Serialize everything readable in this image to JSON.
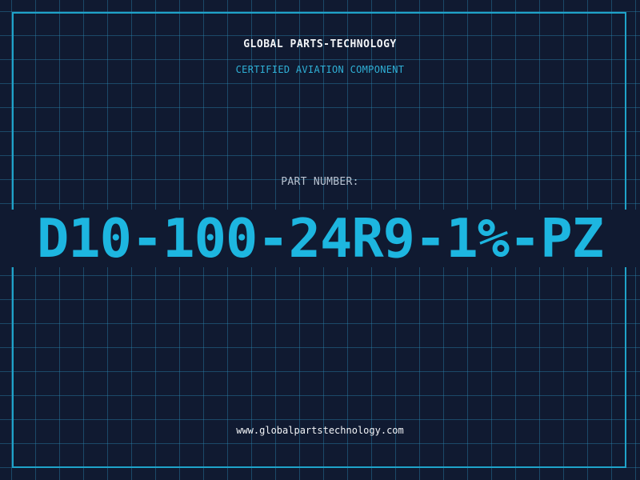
{
  "header": {
    "company_name": "GLOBAL PARTS-TECHNOLOGY",
    "tagline": "CERTIFIED AVIATION COMPONENT"
  },
  "part": {
    "label": "PART NUMBER:",
    "number": "D10-100-24R9-1%-PZ"
  },
  "footer": {
    "website": "www.globalpartstechnology.com"
  },
  "colors": {
    "background": "#101a31",
    "grid": "#28829a",
    "accent": "#1db6e0",
    "text": "#f2f4f7",
    "muted_text": "#b9c3d1"
  }
}
